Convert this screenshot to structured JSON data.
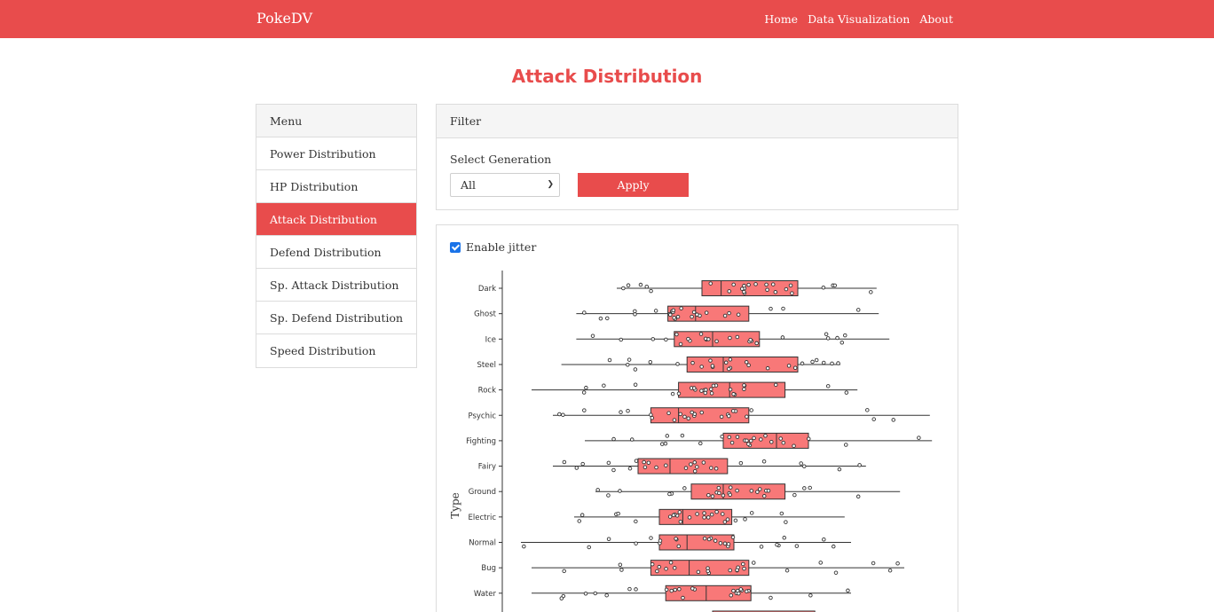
{
  "navbar": {
    "brand": "PokeDV",
    "links": [
      "Home",
      "Data Visualization",
      "About"
    ]
  },
  "page": {
    "title": "Attack Distribution"
  },
  "menu": {
    "header": "Menu",
    "items": [
      "Power Distribution",
      "HP Distribution",
      "Attack Distribution",
      "Defend Distribution",
      "Sp. Attack Distribution",
      "Sp. Defend Distribution",
      "Speed Distribution"
    ],
    "active_index": 2
  },
  "filter": {
    "header": "Filter",
    "generation_label": "Select Generation",
    "generation_value": "All",
    "apply_label": "Apply"
  },
  "jitter": {
    "label": "Enable jitter",
    "checked": true
  },
  "colors": {
    "accent": "#e84c4c",
    "box_fill": "#f87878",
    "checkbox": "#1a73e8"
  },
  "chart_data": {
    "type": "boxplot",
    "ylabel": "Type",
    "categories": [
      "Dark",
      "Ghost",
      "Ice",
      "Steel",
      "Rock",
      "Psychic",
      "Fighting",
      "Fairy",
      "Ground",
      "Electric",
      "Normal",
      "Bug",
      "Water"
    ],
    "boxes": [
      {
        "type": "Dark",
        "min": 50,
        "q1": 90,
        "median": 99,
        "q3": 135,
        "max": 172
      },
      {
        "type": "Ghost",
        "min": 31,
        "q1": 74,
        "median": 87,
        "q3": 112,
        "max": 173
      },
      {
        "type": "Ice",
        "min": 31,
        "q1": 77,
        "median": 95,
        "q3": 117,
        "max": 178
      },
      {
        "type": "Steel",
        "min": 24,
        "q1": 83,
        "median": 100,
        "q3": 135,
        "max": 155
      },
      {
        "type": "Rock",
        "min": 10,
        "q1": 79,
        "median": 103,
        "q3": 129,
        "max": 163
      },
      {
        "type": "Psychic",
        "min": 20,
        "q1": 66,
        "median": 79,
        "q3": 112,
        "max": 197
      },
      {
        "type": "Fighting",
        "min": 35,
        "q1": 100,
        "median": 125,
        "q3": 140,
        "max": 198
      },
      {
        "type": "Fairy",
        "min": 20,
        "q1": 60,
        "median": 75,
        "q3": 102,
        "max": 167
      },
      {
        "type": "Ground",
        "min": 40,
        "q1": 85,
        "median": 100,
        "q3": 129,
        "max": 183
      },
      {
        "type": "Electric",
        "min": 30,
        "q1": 70,
        "median": 81,
        "q3": 104,
        "max": 157
      },
      {
        "type": "Normal",
        "min": 5,
        "q1": 70,
        "median": 83,
        "q3": 105,
        "max": 160
      },
      {
        "type": "Bug",
        "min": 10,
        "q1": 66,
        "median": 84,
        "q3": 112,
        "max": 185
      },
      {
        "type": "Water",
        "min": 10,
        "q1": 73,
        "median": 92,
        "q3": 113,
        "max": 160
      }
    ],
    "show_points": true
  }
}
